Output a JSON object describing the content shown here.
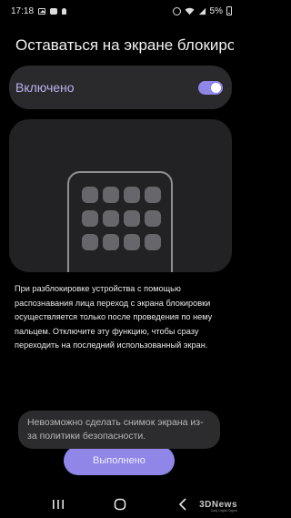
{
  "status_bar": {
    "time": "17:18",
    "left_icons": [
      "image-icon",
      "chat-icon",
      "bulb-icon"
    ],
    "right_icons": [
      "alarm-icon",
      "wifi-icon",
      "signal-icon"
    ],
    "battery": "5%"
  },
  "header": {
    "title": "Оставаться на экране блокиров..."
  },
  "toggle": {
    "label": "Включено",
    "state": true,
    "accent_color": "#8f86e8"
  },
  "description": "При разблокировке устройства с помощью распознавания лица переход с экрана блокировки осуществляется только после проведения по нему пальцем. Отключите эту функцию, чтобы сразу переходить на последний использованный экран.",
  "toast": {
    "text": "Невозможно сделать снимок экрана из-за политики безопасности."
  },
  "done_button": {
    "label": "Выполнено"
  },
  "nav_bar": {
    "items": [
      "recents-icon",
      "home-icon",
      "back-icon"
    ]
  },
  "watermark": {
    "main": "3DNews",
    "sub": "Daily Digital Digest"
  }
}
